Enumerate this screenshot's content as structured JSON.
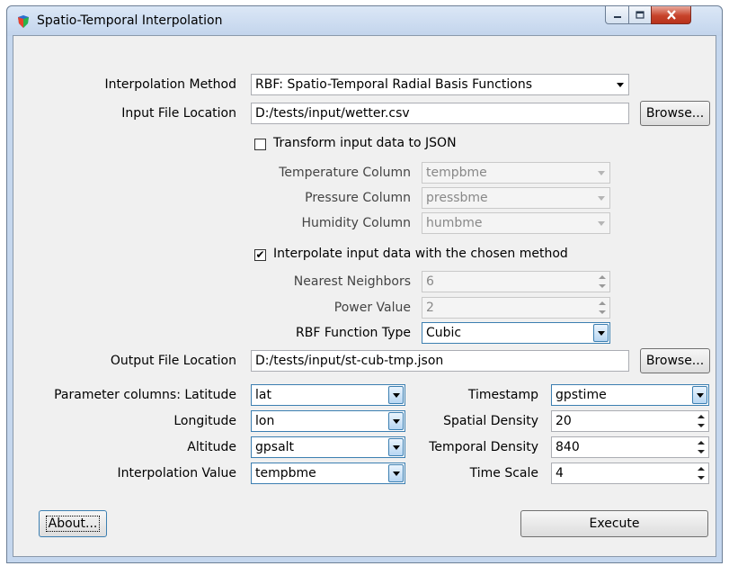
{
  "window": {
    "title": "Spatio-Temporal Interpolation",
    "icon": "app-icon",
    "controls": {
      "minimize": "minimize-icon",
      "maximize": "maximize-icon",
      "close": "close-icon"
    }
  },
  "method": {
    "label": "Interpolation Method",
    "value": "RBF: Spatio-Temporal Radial Basis Functions"
  },
  "input_file": {
    "label": "Input File Location",
    "value": "D:/tests/input/wetter.csv",
    "browse": "Browse..."
  },
  "transform": {
    "label": "Transform input data to JSON",
    "checked": false,
    "temperature": {
      "label": "Temperature Column",
      "value": "tempbme"
    },
    "pressure": {
      "label": "Pressure Column",
      "value": "pressbme"
    },
    "humidity": {
      "label": "Humidity Column",
      "value": "humbme"
    }
  },
  "interpolate": {
    "label": "Interpolate input data with the chosen method",
    "checked": true,
    "check_mark": "✔",
    "neighbors": {
      "label": "Nearest Neighbors",
      "value": "6"
    },
    "power": {
      "label": "Power Value",
      "value": "2"
    },
    "rbf": {
      "label": "RBF Function Type",
      "value": "Cubic"
    }
  },
  "output_file": {
    "label": "Output File Location",
    "value": "D:/tests/input/st-cub-tmp.json",
    "browse": "Browse..."
  },
  "params": {
    "latitude": {
      "label": "Parameter columns: Latitude",
      "value": "lat"
    },
    "longitude": {
      "label": "Longitude",
      "value": "lon"
    },
    "altitude": {
      "label": "Altitude",
      "value": "gpsalt"
    },
    "interp_value": {
      "label": "Interpolation Value",
      "value": "tempbme"
    },
    "timestamp": {
      "label": "Timestamp",
      "value": "gpstime"
    },
    "spatial_density": {
      "label": "Spatial Density",
      "value": "20"
    },
    "temporal_density": {
      "label": "Temporal Density",
      "value": "840"
    },
    "time_scale": {
      "label": "Time Scale",
      "value": "4"
    }
  },
  "buttons": {
    "about": "About...",
    "execute": "Execute"
  },
  "colors": {
    "accent": "#3c7fb1",
    "close": "#c7432b",
    "dialog_bg": "#f0f0f0"
  }
}
